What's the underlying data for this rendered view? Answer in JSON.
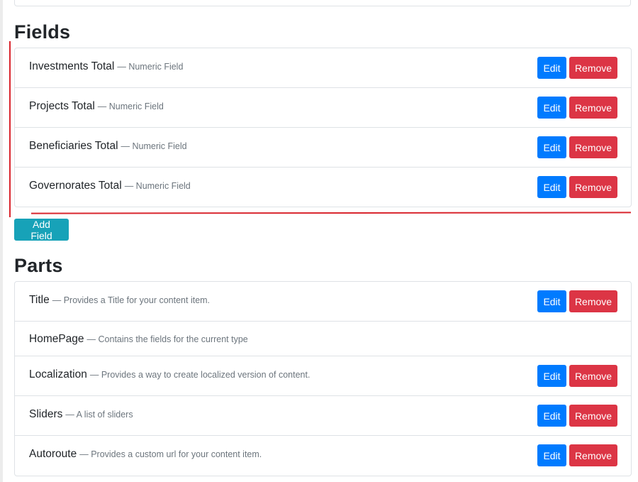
{
  "fields": {
    "heading": "Fields",
    "items": [
      {
        "name": "Investments Total",
        "desc": "— Numeric Field",
        "edit": "Edit",
        "remove": "Remove"
      },
      {
        "name": "Projects Total",
        "desc": "— Numeric Field",
        "edit": "Edit",
        "remove": "Remove"
      },
      {
        "name": "Beneficiaries Total",
        "desc": "— Numeric Field",
        "edit": "Edit",
        "remove": "Remove"
      },
      {
        "name": "Governorates Total",
        "desc": "— Numeric Field",
        "edit": "Edit",
        "remove": "Remove"
      }
    ],
    "add_label": "Add Field"
  },
  "parts": {
    "heading": "Parts",
    "items": [
      {
        "name": "Title",
        "desc": "— Provides a Title for your content item.",
        "edit": "Edit",
        "remove": "Remove"
      },
      {
        "name": "HomePage",
        "desc": "— Contains the fields for the current type"
      },
      {
        "name": "Localization",
        "desc": "— Provides a way to create localized version of content.",
        "edit": "Edit",
        "remove": "Remove"
      },
      {
        "name": "Sliders",
        "desc": "— A list of sliders",
        "edit": "Edit",
        "remove": "Remove"
      },
      {
        "name": "Autoroute",
        "desc": "— Provides a custom url for your content item.",
        "edit": "Edit",
        "remove": "Remove"
      }
    ]
  },
  "colors": {
    "edit": "#007bff",
    "remove": "#dc3545",
    "add": "#17a2b8",
    "annotation": "#d9262e"
  }
}
